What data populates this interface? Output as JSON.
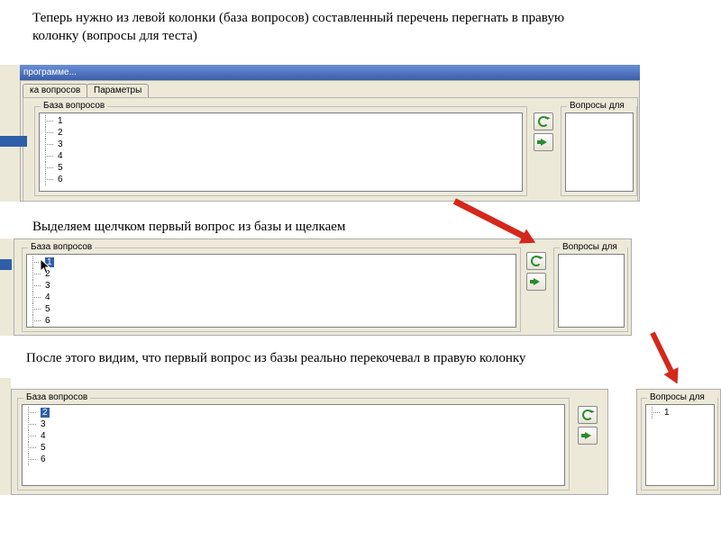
{
  "captions": {
    "c1": "Теперь нужно из левой колонки (база вопросов) составленный перечень перегнать в правую колонку (вопросы для теста)",
    "c2": "Выделяем щелчком первый вопрос из базы и щелкаем",
    "c3": "После этого видим, что первый вопрос из базы реально перекочевал в правую колонку"
  },
  "shot1": {
    "title_fragment": "программе...",
    "tabs": {
      "tab1": "ка вопросов",
      "tab2": "Параметры"
    },
    "left_group": "База вопросов",
    "right_group": "Вопросы для теста",
    "items": [
      "1",
      "2",
      "3",
      "4",
      "5",
      "6"
    ],
    "buttons": {
      "refresh": "refresh",
      "move": "move-right"
    }
  },
  "shot2": {
    "left_group": "База вопросов",
    "right_group": "Вопросы для теста",
    "items": [
      "1",
      "2",
      "3",
      "4",
      "5",
      "6"
    ],
    "selected_index": 0,
    "buttons": {
      "refresh": "refresh",
      "move": "move-right"
    }
  },
  "shot3": {
    "left_group": "База вопросов",
    "right_group": "Вопросы для тес",
    "left_items": [
      "2",
      "3",
      "4",
      "5",
      "6"
    ],
    "left_selected_index": 0,
    "right_items": [
      "1"
    ],
    "buttons": {
      "refresh": "refresh",
      "move": "move-right"
    }
  }
}
